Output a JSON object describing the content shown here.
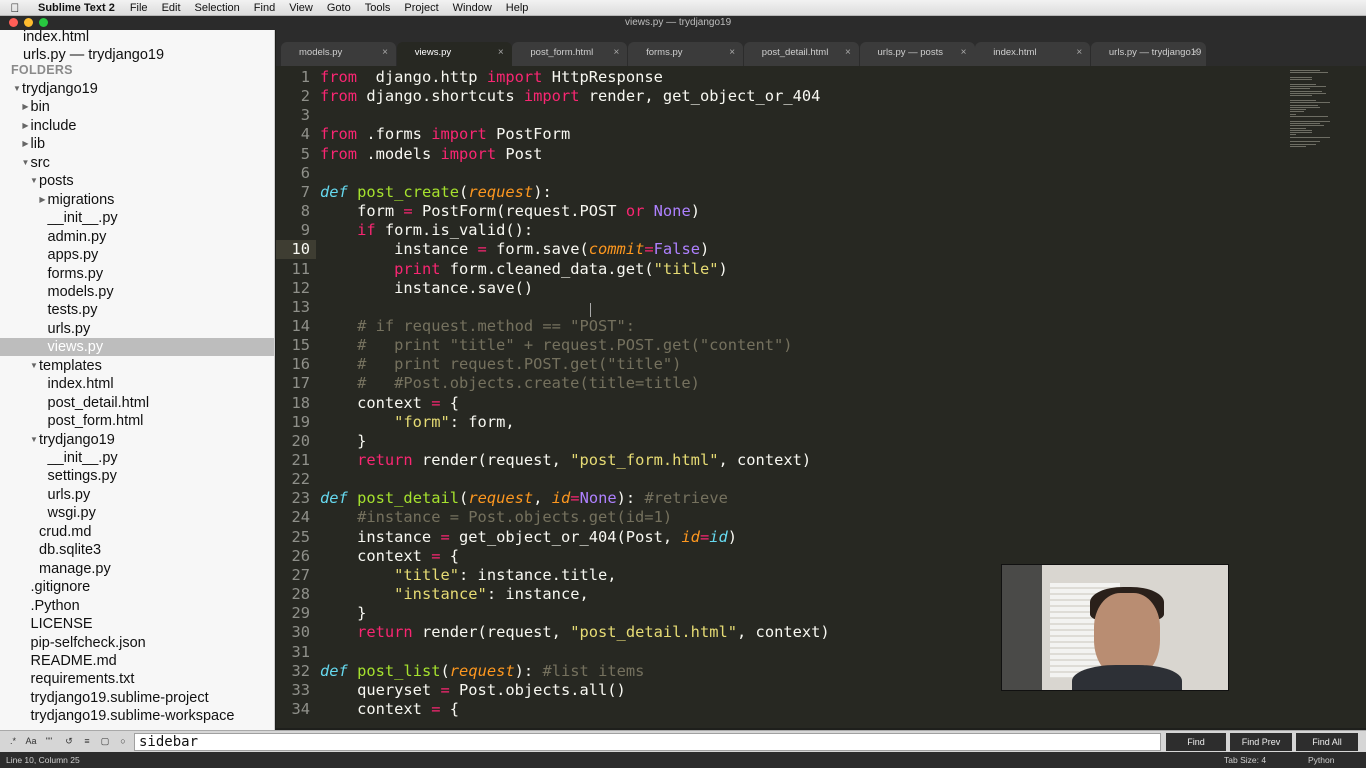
{
  "menubar": {
    "app": "Sublime Text 2",
    "items": [
      "File",
      "Edit",
      "Selection",
      "Find",
      "View",
      "Goto",
      "Tools",
      "Project",
      "Window",
      "Help"
    ]
  },
  "window_title": "views.py — trydjango19",
  "sidebar": {
    "open_files": [
      "index.html",
      "urls.py — trydjango19"
    ],
    "folders_label": "FOLDERS",
    "tree": [
      {
        "label": "trydjango19",
        "arrow": "down"
      },
      {
        "label": "bin",
        "arrow": "right"
      },
      {
        "label": "include",
        "arrow": "right"
      },
      {
        "label": "lib",
        "arrow": "right"
      },
      {
        "label": "src",
        "arrow": "down"
      },
      {
        "label": "posts",
        "arrow": "down"
      },
      {
        "label": "migrations",
        "arrow": "right"
      },
      {
        "label": "__init__.py"
      },
      {
        "label": "admin.py"
      },
      {
        "label": "apps.py"
      },
      {
        "label": "forms.py"
      },
      {
        "label": "models.py"
      },
      {
        "label": "tests.py"
      },
      {
        "label": "urls.py"
      },
      {
        "label": "views.py",
        "selected": true
      },
      {
        "label": "templates",
        "arrow": "down"
      },
      {
        "label": "index.html"
      },
      {
        "label": "post_detail.html"
      },
      {
        "label": "post_form.html"
      },
      {
        "label": "trydjango19",
        "arrow": "down"
      },
      {
        "label": "__init__.py"
      },
      {
        "label": "settings.py"
      },
      {
        "label": "urls.py"
      },
      {
        "label": "wsgi.py"
      },
      {
        "label": "crud.md"
      },
      {
        "label": "db.sqlite3"
      },
      {
        "label": "manage.py"
      },
      {
        "label": ".gitignore"
      },
      {
        "label": ".Python"
      },
      {
        "label": "LICENSE"
      },
      {
        "label": "pip-selfcheck.json"
      },
      {
        "label": "README.md"
      },
      {
        "label": "requirements.txt"
      },
      {
        "label": "trydjango19.sublime-project"
      },
      {
        "label": "trydjango19.sublime-workspace"
      }
    ]
  },
  "tabs": [
    {
      "label": "models.py"
    },
    {
      "label": "views.py",
      "active": true
    },
    {
      "label": "post_form.html"
    },
    {
      "label": "forms.py"
    },
    {
      "label": "post_detail.html"
    },
    {
      "label": "urls.py — posts"
    },
    {
      "label": "index.html"
    },
    {
      "label": "urls.py — trydjango19"
    }
  ],
  "tab_close_glyph": "×",
  "editor": {
    "current_line": 10,
    "lines": [
      [
        [
          "kw",
          "from"
        ],
        [
          "",
          "  django.http "
        ],
        [
          "kw",
          "import"
        ],
        [
          "",
          " HttpResponse"
        ]
      ],
      [
        [
          "kw",
          "from"
        ],
        [
          "",
          "",
          " django.shortcuts "
        ],
        [
          "kw",
          "import"
        ],
        [
          "",
          " render, get_object_or_404"
        ]
      ],
      [],
      [
        [
          "kw",
          "from"
        ],
        [
          "",
          " .forms "
        ],
        [
          "kw",
          "import"
        ],
        [
          "",
          " PostForm"
        ]
      ],
      [
        [
          "kw",
          "from"
        ],
        [
          "",
          " .models "
        ],
        [
          "kw",
          "import"
        ],
        [
          "",
          " Post"
        ]
      ],
      [],
      [
        [
          "def",
          "def"
        ],
        [
          "",
          " "
        ],
        [
          "fn",
          "post_create"
        ],
        [
          "",
          "("
        ],
        [
          "param",
          "request"
        ],
        [
          "",
          "):"
        ]
      ],
      [
        [
          "",
          "    form "
        ],
        [
          "kw",
          "="
        ],
        [
          "",
          " PostForm(request.POST "
        ],
        [
          "kw",
          "or"
        ],
        [
          "",
          " "
        ],
        [
          "const",
          "None"
        ],
        [
          "",
          ")"
        ]
      ],
      [
        [
          "",
          "    "
        ],
        [
          "kw",
          "if"
        ],
        [
          "",
          " form.is_valid():"
        ]
      ],
      [
        [
          "",
          "        instance "
        ],
        [
          "kw",
          "="
        ],
        [
          "",
          " form.save("
        ],
        [
          "param",
          "commit"
        ],
        [
          "kw",
          "="
        ],
        [
          "const",
          "False"
        ],
        [
          "",
          ")"
        ]
      ],
      [
        [
          "",
          "        "
        ],
        [
          "kw",
          "print"
        ],
        [
          "",
          " form.cleaned_data.get("
        ],
        [
          "str",
          "\"title\""
        ],
        [
          "",
          ")"
        ]
      ],
      [
        [
          "",
          "        instance.save()"
        ]
      ],
      [],
      [
        [
          "cmt",
          "    # if request.method == \"POST\":"
        ]
      ],
      [
        [
          "cmt",
          "    #   print \"title\" + request.POST.get(\"content\")"
        ]
      ],
      [
        [
          "cmt",
          "    #   print request.POST.get(\"title\")"
        ]
      ],
      [
        [
          "cmt",
          "    #   #Post.objects.create(title=title)"
        ]
      ],
      [
        [
          "",
          "    context "
        ],
        [
          "kw",
          "="
        ],
        [
          "",
          " {"
        ]
      ],
      [
        [
          "",
          "        "
        ],
        [
          "str",
          "\"form\""
        ],
        [
          "",
          ": form,"
        ]
      ],
      [
        [
          "",
          "    }"
        ]
      ],
      [
        [
          "",
          "    "
        ],
        [
          "kw",
          "return"
        ],
        [
          "",
          " render(request, "
        ],
        [
          "str",
          "\"post_form.html\""
        ],
        [
          "",
          ", context)"
        ]
      ],
      [],
      [
        [
          "def",
          "def"
        ],
        [
          "",
          " "
        ],
        [
          "fn",
          "post_detail"
        ],
        [
          "",
          "("
        ],
        [
          "param",
          "request"
        ],
        [
          "",
          ", "
        ],
        [
          "param",
          "id"
        ],
        [
          "kw",
          "="
        ],
        [
          "const",
          "None"
        ],
        [
          "",
          "): "
        ],
        [
          "cmt",
          "#retrieve"
        ]
      ],
      [
        [
          "cmt",
          "    #instance = Post.objects.get(id=1)"
        ]
      ],
      [
        [
          "",
          "    instance "
        ],
        [
          "kw",
          "="
        ],
        [
          "",
          " get_object_or_404(Post, "
        ],
        [
          "param",
          "id"
        ],
        [
          "kw",
          "="
        ],
        [
          "def",
          "id"
        ],
        [
          "",
          ")"
        ]
      ],
      [
        [
          "",
          "    context "
        ],
        [
          "kw",
          "="
        ],
        [
          "",
          " {"
        ]
      ],
      [
        [
          "",
          "        "
        ],
        [
          "str",
          "\"title\""
        ],
        [
          "",
          ": instance.title,"
        ]
      ],
      [
        [
          "",
          "        "
        ],
        [
          "str",
          "\"instance\""
        ],
        [
          "",
          ": instance,"
        ]
      ],
      [
        [
          "",
          "    }"
        ]
      ],
      [
        [
          "",
          "    "
        ],
        [
          "kw",
          "return"
        ],
        [
          "",
          " render(request, "
        ],
        [
          "str",
          "\"post_detail.html\""
        ],
        [
          "",
          ", context)"
        ]
      ],
      [],
      [
        [
          "def",
          "def"
        ],
        [
          "",
          " "
        ],
        [
          "fn",
          "post_list"
        ],
        [
          "",
          "("
        ],
        [
          "param",
          "request"
        ],
        [
          "",
          "): "
        ],
        [
          "cmt",
          "#list items"
        ]
      ],
      [
        [
          "",
          "    queryset "
        ],
        [
          "kw",
          "="
        ],
        [
          "",
          " Post.objects.all()"
        ]
      ],
      [
        [
          "",
          "    context "
        ],
        [
          "kw",
          "="
        ],
        [
          "",
          " {"
        ]
      ]
    ]
  },
  "find": {
    "options": [
      "Aa",
      "\"\"",
      "[]",
      "↺",
      "≡",
      "▢"
    ],
    "value": "sidebar",
    "find_label": "Find",
    "find_prev_label": "Find Prev",
    "find_all_label": "Find All"
  },
  "status": {
    "position": "Line 10, Column 25",
    "tab_size": "Tab Size: 4",
    "syntax": "Python"
  },
  "colors": {
    "editor_bg": "#272822",
    "keyword": "#f92672",
    "function": "#a6e22e",
    "string": "#e6db74",
    "comment": "#75715e"
  }
}
